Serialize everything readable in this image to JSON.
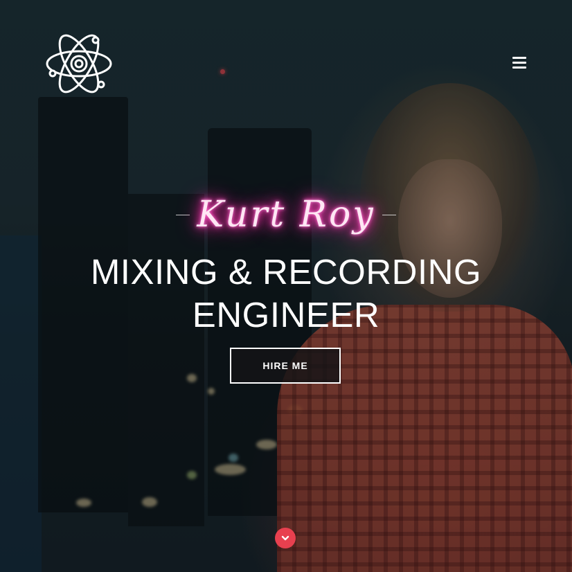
{
  "brand": {
    "logo_icon": "atom-icon"
  },
  "nav": {
    "menu_icon": "hamburger-menu-icon"
  },
  "hero": {
    "name": "Kurt Roy",
    "headline_line1": "MIXING & RECORDING",
    "headline_line2": "ENGINEER",
    "cta_label": "HIRE ME",
    "scroll_icon": "chevron-down-icon"
  },
  "colors": {
    "accent": "#e8404f",
    "neon_pink": "#ff3cb4",
    "text": "#ffffff"
  }
}
